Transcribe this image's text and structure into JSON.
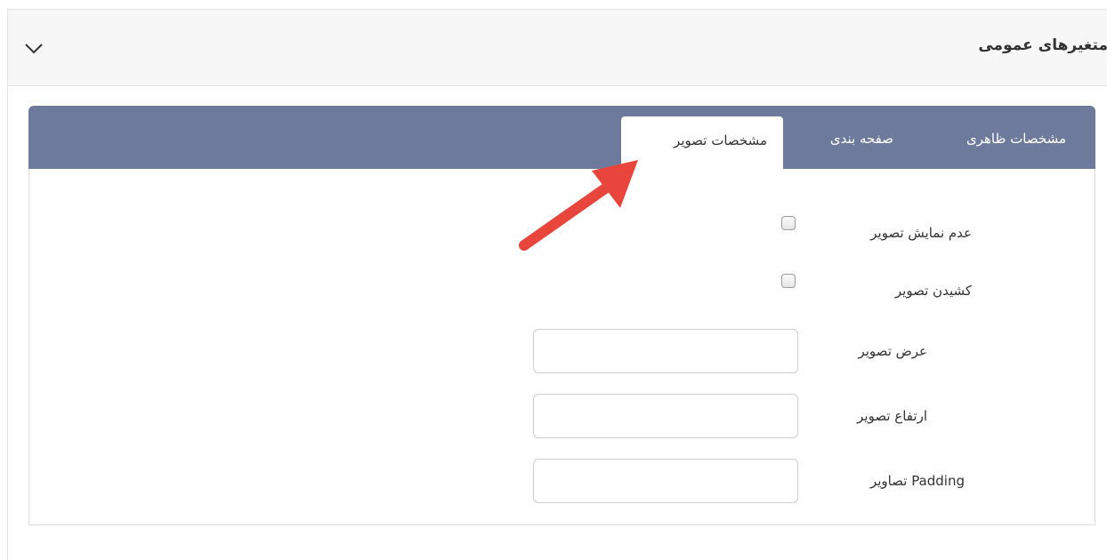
{
  "panel": {
    "title": "متغیرهای عمومی",
    "collapse_icon": "chevron-down-icon"
  },
  "tabs": [
    {
      "label": "مشخصات ظاهری",
      "active": false
    },
    {
      "label": "صفحه بندی",
      "active": false
    },
    {
      "label": "مشخصات تصویر",
      "active": true
    }
  ],
  "form": {
    "hide_image_label": "عدم نمایش تصویر",
    "stretch_image_label": "کشیدن تصویر",
    "image_width_label": "عرض تصویر",
    "image_width_value": "",
    "image_height_label": "ارتفاع تصویر",
    "image_height_value": "",
    "image_padding_label": "Padding تصاویر",
    "image_padding_value": ""
  },
  "colors": {
    "tab_bar": "#6e7a9b",
    "annotation_arrow": "#e8453c"
  }
}
